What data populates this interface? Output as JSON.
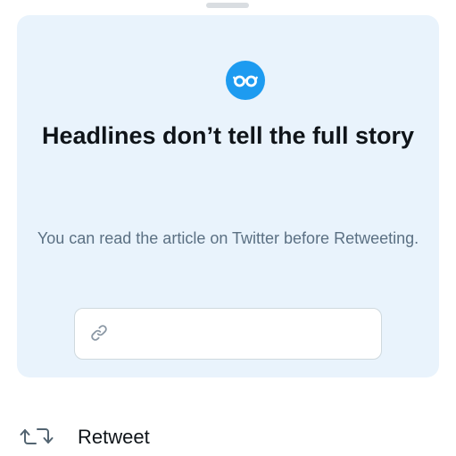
{
  "sheet": {
    "grabber_icon": "drag-handle"
  },
  "prompt": {
    "icon": "glasses-icon",
    "headline": "Headlines don’t tell the full story",
    "subtext": "You can read the article on Twitter before Retweeting.",
    "link_icon": "link-icon",
    "link_value": ""
  },
  "actions": {
    "retweet_icon": "retweet-icon",
    "retweet_label": "Retweet"
  },
  "colors": {
    "accent": "#1d9bf0",
    "card_background": "#e9f3fc",
    "headline_text": "#0f1419",
    "secondary_text": "#5b7083"
  }
}
